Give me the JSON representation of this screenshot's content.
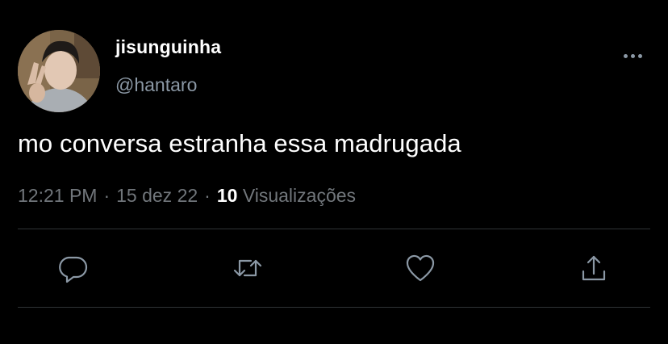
{
  "tweet": {
    "author_name": "jisunguinha",
    "author_handle": "@hantaro",
    "text": "mo conversa estranha essa madrugada",
    "time": "12:21 PM",
    "date": "15 dez 22",
    "views_count": "10",
    "views_label": "Visualizações",
    "separator": "·"
  },
  "icons": {
    "more": "more-options-icon",
    "reply": "reply-icon",
    "retweet": "retweet-icon",
    "like": "heart-icon",
    "share": "share-icon"
  },
  "colors": {
    "background": "#000000",
    "primary_text": "#ffffff",
    "secondary_text": "#8b98a5",
    "divider": "#2f3336"
  }
}
